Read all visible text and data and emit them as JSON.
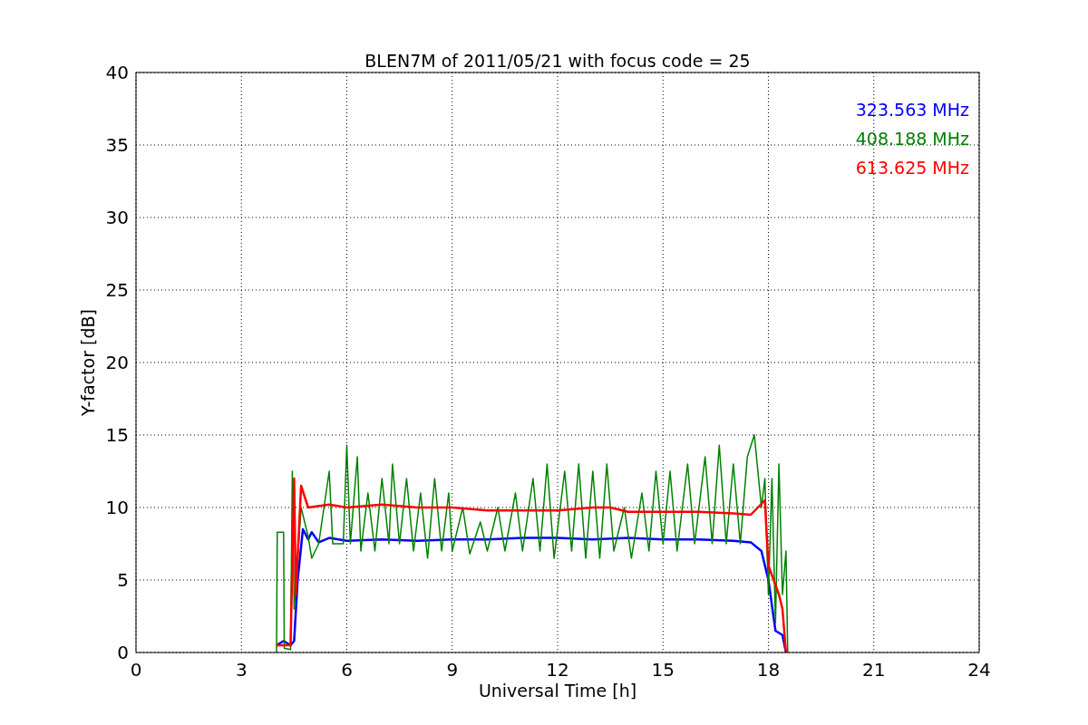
{
  "chart_data": {
    "type": "line",
    "title": "BLEN7M of 2011/05/21 with focus code = 25",
    "xlabel": "Universal Time [h]",
    "ylabel": "Y-factor [dB]",
    "xlim": [
      0,
      24
    ],
    "ylim": [
      0,
      40
    ],
    "xticks": [
      0,
      3,
      6,
      9,
      12,
      15,
      18,
      21,
      24
    ],
    "yticks": [
      0,
      5,
      10,
      15,
      20,
      25,
      30,
      35,
      40
    ],
    "grid": true,
    "series": [
      {
        "name": "323.563 MHz",
        "color": "#0000ff",
        "x": [
          4.0,
          4.2,
          4.4,
          4.5,
          4.6,
          4.75,
          4.9,
          5.0,
          5.2,
          5.5,
          6,
          7,
          8,
          9,
          10,
          11,
          12,
          13,
          14,
          15,
          16,
          17,
          17.5,
          17.8,
          18.0,
          18.2,
          18.4,
          18.5
        ],
        "values": [
          0.5,
          0.8,
          0.5,
          0.8,
          5,
          8.5,
          7.8,
          8.3,
          7.6,
          7.9,
          7.7,
          7.8,
          7.7,
          7.8,
          7.8,
          7.9,
          7.9,
          7.8,
          7.9,
          7.8,
          7.8,
          7.7,
          7.6,
          7,
          5,
          1.5,
          1.2,
          0
        ]
      },
      {
        "name": "408.188 MHz",
        "color": "#008000",
        "x": [
          4.0,
          4.02,
          4.2,
          4.22,
          4.4,
          4.45,
          4.5,
          4.7,
          4.9,
          5.0,
          5.2,
          5.5,
          5.6,
          5.9,
          6.0,
          6.1,
          6.3,
          6.4,
          6.6,
          6.8,
          7.0,
          7.2,
          7.3,
          7.5,
          7.7,
          7.9,
          8.1,
          8.3,
          8.5,
          8.7,
          8.9,
          9.0,
          9.3,
          9.5,
          9.8,
          10.0,
          10.3,
          10.5,
          10.8,
          11.0,
          11.3,
          11.5,
          11.7,
          11.9,
          12.2,
          12.4,
          12.6,
          12.8,
          13.0,
          13.2,
          13.4,
          13.6,
          13.9,
          14.1,
          14.4,
          14.6,
          14.8,
          15.0,
          15.2,
          15.4,
          15.7,
          15.9,
          16.2,
          16.4,
          16.6,
          16.8,
          17.0,
          17.2,
          17.4,
          17.6,
          17.8,
          17.9,
          18.0,
          18.1,
          18.2,
          18.3,
          18.4,
          18.5,
          18.55
        ],
        "values": [
          0,
          8.3,
          8.3,
          0.3,
          0.2,
          12.5,
          3,
          10,
          8,
          6.5,
          7.5,
          12.5,
          7.5,
          7.5,
          14.3,
          7.5,
          13.5,
          7,
          11,
          7,
          12,
          7.5,
          13,
          7.5,
          12,
          7,
          11,
          6.5,
          12,
          7,
          11,
          7,
          10,
          6.8,
          9,
          7,
          10,
          7,
          11,
          7,
          12,
          7,
          13,
          6.5,
          12.5,
          7,
          13,
          6.5,
          12.5,
          6.5,
          13,
          7,
          10,
          6.5,
          11,
          7,
          12.5,
          7.5,
          12.5,
          7,
          13,
          7.5,
          13.5,
          7.5,
          14.3,
          7.5,
          13,
          7.5,
          13.5,
          15,
          10,
          12,
          4,
          12,
          2,
          13,
          4,
          7,
          0
        ]
      },
      {
        "name": "613.625 MHz",
        "color": "#ff0000",
        "x": [
          4.0,
          4.4,
          4.5,
          4.55,
          4.7,
          4.9,
          5.5,
          6,
          7,
          8,
          9,
          10,
          11,
          12,
          13,
          13.5,
          14,
          15,
          16,
          17,
          17.5,
          17.9,
          18.0,
          18.3,
          18.4,
          18.5
        ],
        "values": [
          0.5,
          0.5,
          12,
          4,
          11.5,
          10,
          10.2,
          10,
          10.2,
          10,
          10,
          9.8,
          9.8,
          9.8,
          10,
          10,
          9.7,
          9.7,
          9.7,
          9.6,
          9.5,
          10.5,
          6,
          4,
          3,
          0
        ]
      }
    ]
  }
}
